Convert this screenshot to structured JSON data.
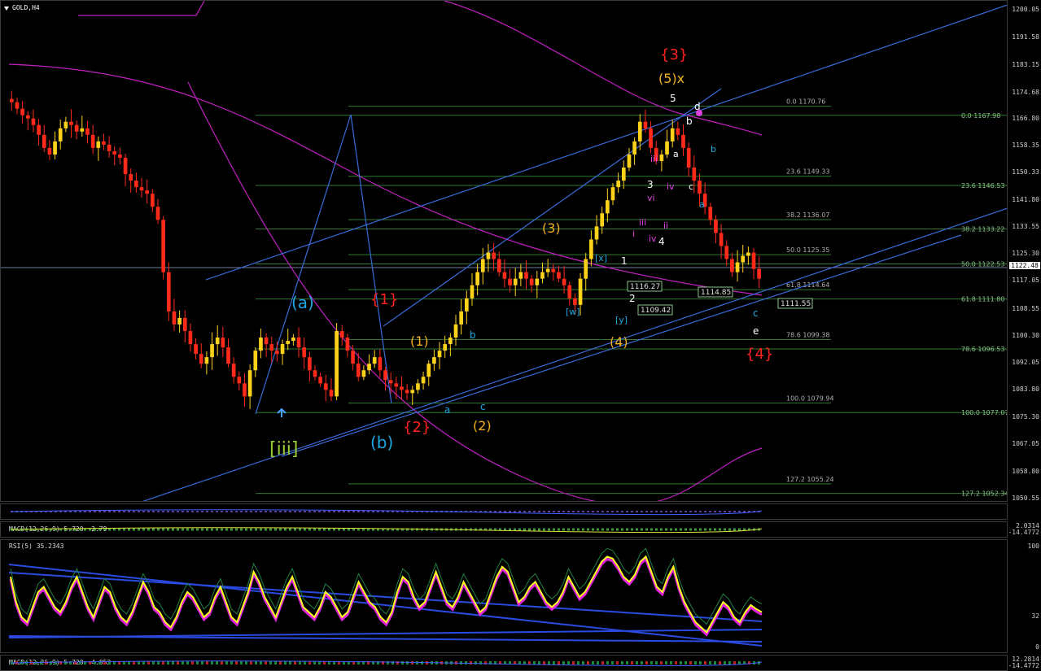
{
  "chart_title": "GOLD,H4",
  "current_price": "1122.48",
  "colors": {
    "bull": "#ffd21a",
    "bear": "#ff2a1a",
    "fib": "#2f7a2f",
    "ma": "#c020c0",
    "trend": "#3a6bd9",
    "wave_red": "#ff2020",
    "wave_orange": "#f0b020",
    "wave_cyan": "#1ea7e0",
    "wave_white": "#ffffff",
    "wave_green": "#9acd32",
    "wave_magenta": "#e040e0"
  },
  "chart_data": {
    "type": "candlestick",
    "symbol": "GOLD",
    "timeframe": "H4",
    "ylim": [
      1050,
      1203
    ],
    "y_ticks": [
      "1200.05",
      "1191.58",
      "1183.15",
      "1174.68",
      "1166.80",
      "1158.35",
      "1150.33",
      "1141.80",
      "1133.55",
      "1125.30",
      "1117.05",
      "1108.55",
      "1100.30",
      "1092.05",
      "1083.80",
      "1075.30",
      "1067.05",
      "1058.80",
      "1050.55"
    ],
    "closes": [
      1172,
      1170,
      1168,
      1167,
      1165,
      1162,
      1158,
      1156,
      1160,
      1164,
      1166,
      1165,
      1163,
      1164,
      1162,
      1158,
      1160,
      1159,
      1157,
      1156,
      1155,
      1150,
      1148,
      1146,
      1145,
      1144,
      1140,
      1136,
      1120,
      1108,
      1104,
      1106,
      1102,
      1098,
      1095,
      1092,
      1094,
      1098,
      1100,
      1097,
      1092,
      1088,
      1086,
      1082,
      1090,
      1096,
      1100,
      1098,
      1096,
      1095,
      1098,
      1099,
      1100,
      1097,
      1094,
      1090,
      1088,
      1086,
      1084,
      1082,
      1102,
      1100,
      1096,
      1092,
      1088,
      1090,
      1092,
      1094,
      1090,
      1087,
      1086,
      1085,
      1084,
      1083,
      1084,
      1086,
      1088,
      1092,
      1094,
      1096,
      1098,
      1100,
      1104,
      1108,
      1112,
      1116,
      1120,
      1124,
      1126,
      1124,
      1120,
      1118,
      1116,
      1118,
      1120,
      1118,
      1116,
      1118,
      1120,
      1121,
      1120,
      1118,
      1116,
      1112,
      1110,
      1118,
      1124,
      1130,
      1134,
      1138,
      1142,
      1146,
      1148,
      1152,
      1156,
      1160,
      1166,
      1164,
      1158,
      1154,
      1156,
      1160,
      1164,
      1162,
      1158,
      1152,
      1148,
      1144,
      1140,
      1136,
      1132,
      1128,
      1124,
      1120,
      1123,
      1125,
      1126,
      1121,
      1118
    ],
    "fib_left": [
      {
        "pct": "0.0",
        "price": "1170.76",
        "y": 1170.76
      },
      {
        "pct": "23.6",
        "price": "1149.33",
        "y": 1149.33
      },
      {
        "pct": "38.2",
        "price": "1136.07",
        "y": 1136.07
      },
      {
        "pct": "50.0",
        "price": "1125.35",
        "y": 1125.35
      },
      {
        "pct": "61.8",
        "price": "1114.64",
        "y": 1114.64
      },
      {
        "pct": "78.6",
        "price": "1099.38",
        "y": 1099.38
      },
      {
        "pct": "100.0",
        "price": "1079.94",
        "y": 1079.94
      },
      {
        "pct": "127.2",
        "price": "1055.24",
        "y": 1055.24
      }
    ],
    "fib_right": [
      {
        "pct": "0.0",
        "price": "1167.98",
        "y": 1167.98
      },
      {
        "pct": "23.6",
        "price": "1146.53",
        "y": 1146.53
      },
      {
        "pct": "38.2",
        "price": "1133.22",
        "y": 1133.22
      },
      {
        "pct": "50.0",
        "price": "1122.53",
        "y": 1122.53
      },
      {
        "pct": "61.8",
        "price": "1111.80",
        "y": 1111.8
      },
      {
        "pct": "78.6",
        "price": "1096.53",
        "y": 1096.53
      },
      {
        "pct": "100.0",
        "price": "1077.07",
        "y": 1077.07
      },
      {
        "pct": "127.2",
        "price": "1052.34",
        "y": 1052.34
      }
    ],
    "price_boxes": [
      "1116.27",
      "1114.85",
      "1109.42",
      "1111.55"
    ],
    "wave_labels": [
      {
        "text": "{3}",
        "color": "wave_red",
        "size": 18
      },
      {
        "text": "(5)x",
        "color": "wave_orange",
        "size": 16
      },
      {
        "text": "5",
        "color": "wave_white",
        "size": 12
      },
      {
        "text": "d",
        "color": "wave_white",
        "size": 12
      },
      {
        "text": "b",
        "color": "wave_white",
        "size": 12
      },
      {
        "text": "b",
        "color": "wave_cyan",
        "size": 11
      },
      {
        "text": "iii",
        "color": "wave_magenta",
        "size": 11
      },
      {
        "text": "a",
        "color": "wave_white",
        "size": 11
      },
      {
        "text": "3",
        "color": "wave_white",
        "size": 12
      },
      {
        "text": "c",
        "color": "wave_white",
        "size": 11
      },
      {
        "text": "vi",
        "color": "wave_magenta",
        "size": 11
      },
      {
        "text": "iv",
        "color": "wave_magenta",
        "size": 11
      },
      {
        "text": "a",
        "color": "wave_cyan",
        "size": 11
      },
      {
        "text": "iii",
        "color": "wave_magenta",
        "size": 11
      },
      {
        "text": "ii",
        "color": "wave_magenta",
        "size": 11
      },
      {
        "text": "i",
        "color": "wave_magenta",
        "size": 11
      },
      {
        "text": "iv",
        "color": "wave_magenta",
        "size": 11
      },
      {
        "text": "4",
        "color": "wave_white",
        "size": 12
      },
      {
        "text": "(3)",
        "color": "wave_orange",
        "size": 16
      },
      {
        "text": "[x]",
        "color": "wave_cyan",
        "size": 11
      },
      {
        "text": "1",
        "color": "wave_white",
        "size": 12
      },
      {
        "text": "[w]",
        "color": "wave_cyan",
        "size": 11
      },
      {
        "text": "2",
        "color": "wave_white",
        "size": 12
      },
      {
        "text": "[y]",
        "color": "wave_cyan",
        "size": 11
      },
      {
        "text": "(4)",
        "color": "wave_orange",
        "size": 16
      },
      {
        "text": "c",
        "color": "wave_cyan",
        "size": 12
      },
      {
        "text": "e",
        "color": "wave_white",
        "size": 12
      },
      {
        "text": "{4}",
        "color": "wave_red",
        "size": 18
      },
      {
        "text": "(a)",
        "color": "wave_cyan",
        "size": 20
      },
      {
        "text": "{1}",
        "color": "wave_red",
        "size": 18
      },
      {
        "text": "(1)",
        "color": "wave_orange",
        "size": 16
      },
      {
        "text": "b",
        "color": "wave_cyan",
        "size": 12
      },
      {
        "text": "a",
        "color": "wave_cyan",
        "size": 12
      },
      {
        "text": "c",
        "color": "wave_cyan",
        "size": 12
      },
      {
        "text": "(2)",
        "color": "wave_orange",
        "size": 16
      },
      {
        "text": "{2}",
        "color": "wave_red",
        "size": 18
      },
      {
        "text": "(b)",
        "color": "wave_cyan",
        "size": 20
      },
      {
        "text": "[iii]",
        "color": "wave_green",
        "size": 22
      }
    ]
  },
  "indicators": {
    "macd1_label": "MACD(12,26,9) 5.720 -2.79",
    "macd1_axis_top": "2.0314",
    "macd1_axis_bottom": "-14.4772",
    "rsi_label": "RSI(5) 35.2343",
    "rsi_axis": [
      "100",
      "32",
      "0"
    ],
    "rsi_series": [
      70,
      45,
      30,
      25,
      40,
      55,
      60,
      50,
      40,
      35,
      45,
      60,
      70,
      55,
      40,
      30,
      45,
      60,
      55,
      40,
      30,
      25,
      35,
      50,
      65,
      55,
      40,
      35,
      25,
      20,
      30,
      45,
      55,
      50,
      40,
      30,
      35,
      50,
      60,
      45,
      30,
      25,
      40,
      55,
      75,
      65,
      50,
      40,
      30,
      45,
      60,
      70,
      55,
      40,
      35,
      30,
      40,
      55,
      50,
      40,
      30,
      35,
      50,
      65,
      55,
      45,
      40,
      30,
      25,
      35,
      55,
      70,
      65,
      50,
      40,
      45,
      60,
      75,
      60,
      45,
      40,
      50,
      65,
      55,
      45,
      35,
      40,
      55,
      70,
      80,
      75,
      60,
      45,
      50,
      60,
      65,
      55,
      45,
      40,
      45,
      55,
      70,
      60,
      50,
      55,
      65,
      75,
      85,
      90,
      88,
      80,
      70,
      65,
      72,
      85,
      90,
      75,
      60,
      55,
      70,
      80,
      60,
      45,
      35,
      25,
      20,
      15,
      25,
      35,
      45,
      40,
      30,
      25,
      35,
      42,
      38,
      35
    ],
    "macd2_label": "MACD(12,26,9) 5.720 -4.052",
    "macd2_axis": [
      "12.2814",
      "-14.4772"
    ]
  }
}
